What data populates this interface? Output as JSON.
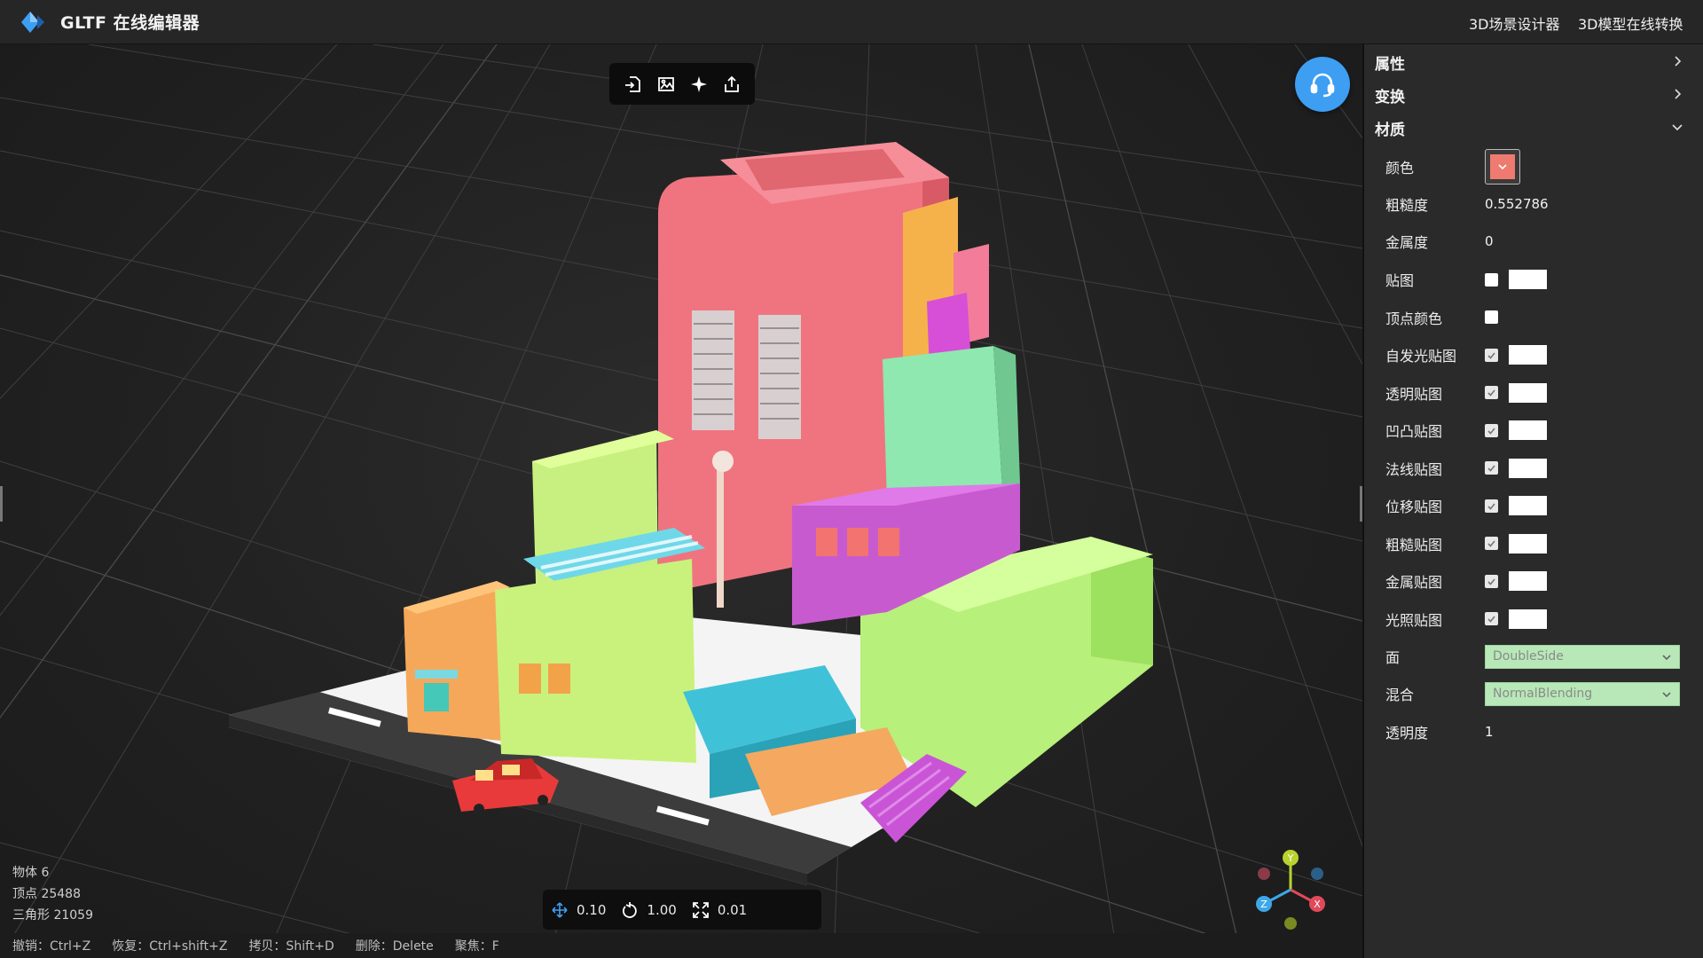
{
  "header": {
    "title": "GLTF 在线编辑器",
    "links": [
      "3D场景设计器",
      "3D模型在线转换"
    ]
  },
  "toolbar": {
    "icons": [
      "import-icon",
      "import-image-icon",
      "light-icon",
      "export-icon"
    ]
  },
  "stats": {
    "objects": "物体 6",
    "vertices": "顶点 25488",
    "triangles": "三角形 21059"
  },
  "transform": {
    "translate": "0.10",
    "rotate": "1.00",
    "scale": "0.01"
  },
  "shortcuts": [
    "撤销：Ctrl+Z",
    "恢复：Ctrl+shift+Z",
    "拷贝：Shift+D",
    "删除：Delete",
    "聚焦：F"
  ],
  "panel": {
    "sections": [
      "属性",
      "变换",
      "材质"
    ],
    "material": {
      "color_label": "颜色",
      "color_value": "#ee7a70",
      "roughness_label": "粗糙度",
      "roughness_value": "0.552786",
      "metalness_label": "金属度",
      "metalness_value": "0",
      "maps": [
        {
          "label": "贴图",
          "checked": false,
          "has_preview": true
        },
        {
          "label": "顶点颜色",
          "checked": false,
          "has_preview": false
        },
        {
          "label": "自发光贴图",
          "checked": true,
          "has_preview": true
        },
        {
          "label": "透明贴图",
          "checked": true,
          "has_preview": true
        },
        {
          "label": "凹凸贴图",
          "checked": true,
          "has_preview": true
        },
        {
          "label": "法线贴图",
          "checked": true,
          "has_preview": true
        },
        {
          "label": "位移贴图",
          "checked": true,
          "has_preview": true
        },
        {
          "label": "粗糙贴图",
          "checked": true,
          "has_preview": true
        },
        {
          "label": "金属贴图",
          "checked": true,
          "has_preview": true
        },
        {
          "label": "光照贴图",
          "checked": true,
          "has_preview": true
        }
      ],
      "side_label": "面",
      "side_value": "DoubleSide",
      "blend_label": "混合",
      "blend_value": "NormalBlending",
      "opacity_label": "透明度",
      "opacity_value": "1"
    }
  },
  "axis": {
    "x": "X",
    "y": "Y",
    "z": "Z"
  },
  "colors": {
    "accent": "#3d9ef2",
    "panel_bg": "#2a2a2a",
    "select_bg": "#b8e8b8"
  }
}
